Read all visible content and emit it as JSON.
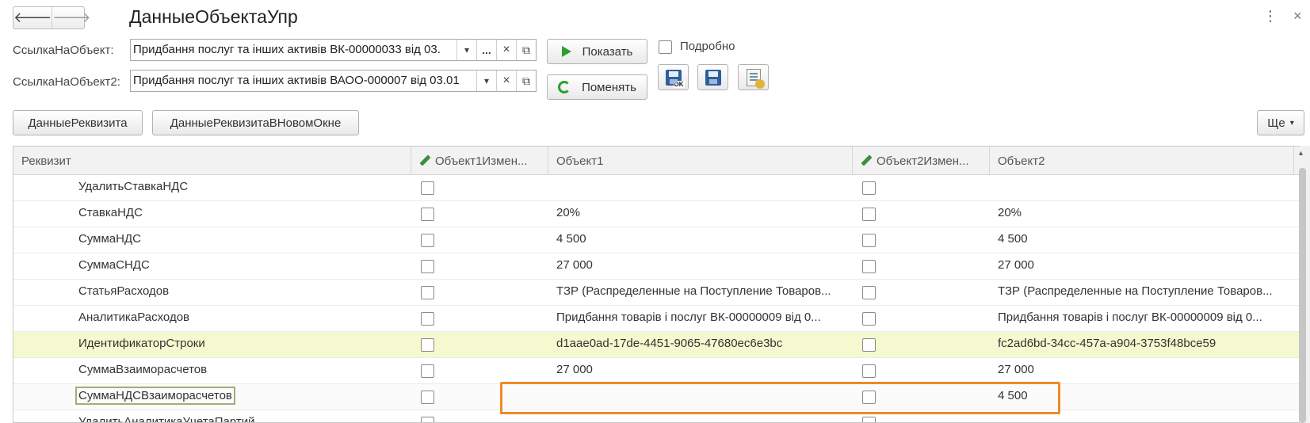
{
  "window": {
    "title": "ДанныеОбъектаУпр",
    "back_symbol": "🡐",
    "forward_symbol": "🡒",
    "more_symbol": "⋮",
    "close_symbol": "×"
  },
  "fields": {
    "ref1_label": "СсылкаНаОбъект:",
    "ref1_value": "Придбання послуг та інших активів ВК-00000033 від 03.",
    "ref2_label": "СсылкаНаОбъект2:",
    "ref2_value": "Придбання послуг та інших активів ВАОО-000007 від 03.01",
    "dropdown_symbol": "▾",
    "select_symbol": "...",
    "clear_symbol": "×",
    "open_symbol": "⧉"
  },
  "toolbar": {
    "show_label": "Показать",
    "change_label": "Поменять",
    "details_label": "Подробно",
    "details_checked": false,
    "save_ok_text": "OK",
    "attr_data_label": "ДанныеРеквизита",
    "attr_data_new_window_label": "ДанныеРеквизитаВНовомОкне",
    "more_label": "Ще",
    "more_arrow": "▾"
  },
  "table": {
    "columns": [
      "Реквизит",
      "Объект1Измен...",
      "Объект1",
      "Объект2Измен...",
      "Объект2"
    ],
    "rows": [
      {
        "name": "УдалитьСтавкаНДС",
        "obj1": "",
        "obj2": ""
      },
      {
        "name": "СтавкаНДС",
        "obj1": "20%",
        "obj2": "20%"
      },
      {
        "name": "СуммаНДС",
        "obj1": "4 500",
        "obj2": "4 500"
      },
      {
        "name": "СуммаСНДС",
        "obj1": "27 000",
        "obj2": "27 000"
      },
      {
        "name": "СтатьяРасходов",
        "obj1": "ТЗР (Распределенные на Поступление Товаров...",
        "obj2": "ТЗР (Распределенные на Поступление Товаров..."
      },
      {
        "name": "АналитикаРасходов",
        "obj1": "Придбання товарів і послуг ВК-00000009 від 0...",
        "obj2": "Придбання товарів і послуг ВК-00000009 від 0..."
      },
      {
        "name": "ИдентификаторСтроки",
        "obj1": "d1aae0ad-17de-4451-9065-47680ec6e3bc",
        "obj2": "fc2ad6bd-34cc-457a-a904-3753f48bce59"
      },
      {
        "name": "СуммаВзаиморасчетов",
        "obj1": "27 000",
        "obj2": "27 000"
      },
      {
        "name": "СуммаНДСВзаиморасчетов",
        "obj1": "",
        "obj2": "4 500"
      },
      {
        "name": "УдалитьАналитикаУчетаПартий",
        "obj1": "",
        "obj2": ""
      }
    ],
    "scroll_up_symbol": "▲"
  },
  "colors": {
    "accent_green": "#2f9e2f",
    "highlight_row": "#f6f9cf",
    "annotation_orange": "#f08a24"
  }
}
